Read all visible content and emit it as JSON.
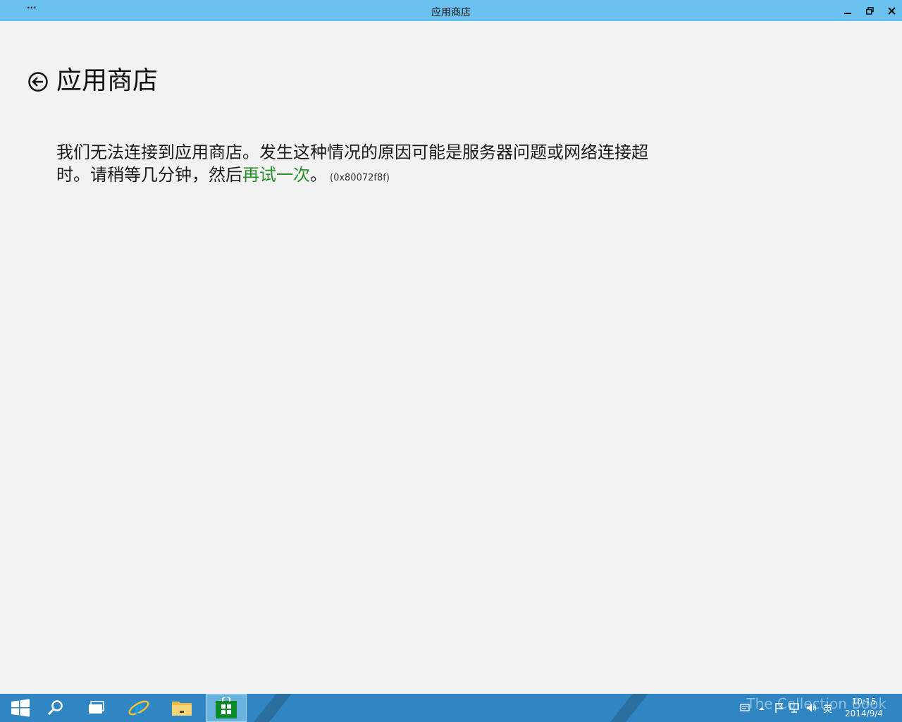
{
  "window": {
    "title": "应用商店",
    "menu_glyph": "···"
  },
  "header": {
    "title": "应用商店"
  },
  "message": {
    "text_before": "我们无法连接到应用商店。发生这种情况的原因可能是服务器问题或网络连接超时。请稍等几分钟，然后",
    "retry_link": "再试一次",
    "text_after": "。",
    "error_code": "(0x80072f8f)"
  },
  "taskbar": {
    "items": [
      {
        "name": "start",
        "icon": "windows-logo-icon"
      },
      {
        "name": "search",
        "icon": "search-icon"
      },
      {
        "name": "task-view",
        "icon": "task-view-icon"
      },
      {
        "name": "internet-explorer",
        "icon": "ie-icon"
      },
      {
        "name": "file-explorer",
        "icon": "folder-icon"
      },
      {
        "name": "store",
        "icon": "store-icon",
        "active": true
      }
    ],
    "tray": {
      "language": "英",
      "time": "10:15",
      "date": "2014/9/4",
      "watermark": "The Collection Book"
    }
  },
  "colors": {
    "titlebar": "#6ac1ef",
    "background": "#f2f2f2",
    "link": "#2a8f2a",
    "taskbar": "#2f86c2"
  }
}
